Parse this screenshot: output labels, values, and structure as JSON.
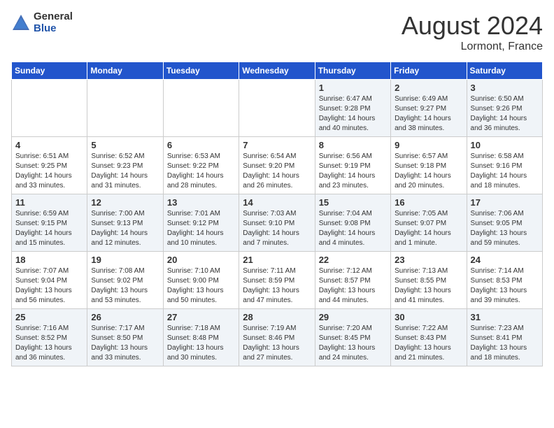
{
  "logo": {
    "general": "General",
    "blue": "Blue"
  },
  "title": "August 2024",
  "location": "Lormont, France",
  "days_header": [
    "Sunday",
    "Monday",
    "Tuesday",
    "Wednesday",
    "Thursday",
    "Friday",
    "Saturday"
  ],
  "weeks": [
    [
      {
        "day": "",
        "info": ""
      },
      {
        "day": "",
        "info": ""
      },
      {
        "day": "",
        "info": ""
      },
      {
        "day": "",
        "info": ""
      },
      {
        "day": "1",
        "info": "Sunrise: 6:47 AM\nSunset: 9:28 PM\nDaylight: 14 hours\nand 40 minutes."
      },
      {
        "day": "2",
        "info": "Sunrise: 6:49 AM\nSunset: 9:27 PM\nDaylight: 14 hours\nand 38 minutes."
      },
      {
        "day": "3",
        "info": "Sunrise: 6:50 AM\nSunset: 9:26 PM\nDaylight: 14 hours\nand 36 minutes."
      }
    ],
    [
      {
        "day": "4",
        "info": "Sunrise: 6:51 AM\nSunset: 9:25 PM\nDaylight: 14 hours\nand 33 minutes."
      },
      {
        "day": "5",
        "info": "Sunrise: 6:52 AM\nSunset: 9:23 PM\nDaylight: 14 hours\nand 31 minutes."
      },
      {
        "day": "6",
        "info": "Sunrise: 6:53 AM\nSunset: 9:22 PM\nDaylight: 14 hours\nand 28 minutes."
      },
      {
        "day": "7",
        "info": "Sunrise: 6:54 AM\nSunset: 9:20 PM\nDaylight: 14 hours\nand 26 minutes."
      },
      {
        "day": "8",
        "info": "Sunrise: 6:56 AM\nSunset: 9:19 PM\nDaylight: 14 hours\nand 23 minutes."
      },
      {
        "day": "9",
        "info": "Sunrise: 6:57 AM\nSunset: 9:18 PM\nDaylight: 14 hours\nand 20 minutes."
      },
      {
        "day": "10",
        "info": "Sunrise: 6:58 AM\nSunset: 9:16 PM\nDaylight: 14 hours\nand 18 minutes."
      }
    ],
    [
      {
        "day": "11",
        "info": "Sunrise: 6:59 AM\nSunset: 9:15 PM\nDaylight: 14 hours\nand 15 minutes."
      },
      {
        "day": "12",
        "info": "Sunrise: 7:00 AM\nSunset: 9:13 PM\nDaylight: 14 hours\nand 12 minutes."
      },
      {
        "day": "13",
        "info": "Sunrise: 7:01 AM\nSunset: 9:12 PM\nDaylight: 14 hours\nand 10 minutes."
      },
      {
        "day": "14",
        "info": "Sunrise: 7:03 AM\nSunset: 9:10 PM\nDaylight: 14 hours\nand 7 minutes."
      },
      {
        "day": "15",
        "info": "Sunrise: 7:04 AM\nSunset: 9:08 PM\nDaylight: 14 hours\nand 4 minutes."
      },
      {
        "day": "16",
        "info": "Sunrise: 7:05 AM\nSunset: 9:07 PM\nDaylight: 14 hours\nand 1 minute."
      },
      {
        "day": "17",
        "info": "Sunrise: 7:06 AM\nSunset: 9:05 PM\nDaylight: 13 hours\nand 59 minutes."
      }
    ],
    [
      {
        "day": "18",
        "info": "Sunrise: 7:07 AM\nSunset: 9:04 PM\nDaylight: 13 hours\nand 56 minutes."
      },
      {
        "day": "19",
        "info": "Sunrise: 7:08 AM\nSunset: 9:02 PM\nDaylight: 13 hours\nand 53 minutes."
      },
      {
        "day": "20",
        "info": "Sunrise: 7:10 AM\nSunset: 9:00 PM\nDaylight: 13 hours\nand 50 minutes."
      },
      {
        "day": "21",
        "info": "Sunrise: 7:11 AM\nSunset: 8:59 PM\nDaylight: 13 hours\nand 47 minutes."
      },
      {
        "day": "22",
        "info": "Sunrise: 7:12 AM\nSunset: 8:57 PM\nDaylight: 13 hours\nand 44 minutes."
      },
      {
        "day": "23",
        "info": "Sunrise: 7:13 AM\nSunset: 8:55 PM\nDaylight: 13 hours\nand 41 minutes."
      },
      {
        "day": "24",
        "info": "Sunrise: 7:14 AM\nSunset: 8:53 PM\nDaylight: 13 hours\nand 39 minutes."
      }
    ],
    [
      {
        "day": "25",
        "info": "Sunrise: 7:16 AM\nSunset: 8:52 PM\nDaylight: 13 hours\nand 36 minutes."
      },
      {
        "day": "26",
        "info": "Sunrise: 7:17 AM\nSunset: 8:50 PM\nDaylight: 13 hours\nand 33 minutes."
      },
      {
        "day": "27",
        "info": "Sunrise: 7:18 AM\nSunset: 8:48 PM\nDaylight: 13 hours\nand 30 minutes."
      },
      {
        "day": "28",
        "info": "Sunrise: 7:19 AM\nSunset: 8:46 PM\nDaylight: 13 hours\nand 27 minutes."
      },
      {
        "day": "29",
        "info": "Sunrise: 7:20 AM\nSunset: 8:45 PM\nDaylight: 13 hours\nand 24 minutes."
      },
      {
        "day": "30",
        "info": "Sunrise: 7:22 AM\nSunset: 8:43 PM\nDaylight: 13 hours\nand 21 minutes."
      },
      {
        "day": "31",
        "info": "Sunrise: 7:23 AM\nSunset: 8:41 PM\nDaylight: 13 hours\nand 18 minutes."
      }
    ]
  ]
}
